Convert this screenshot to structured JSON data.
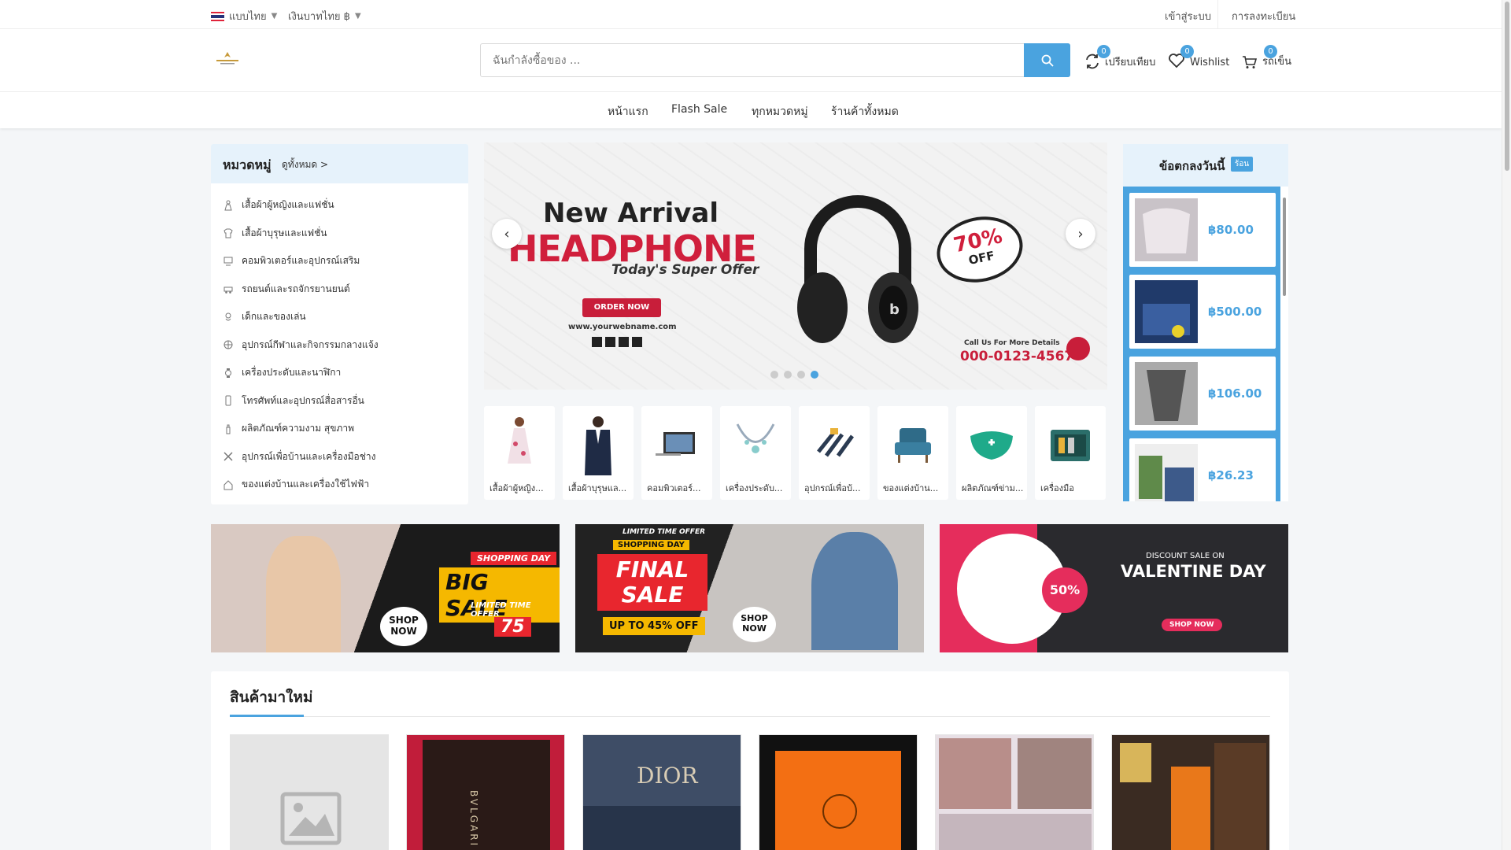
{
  "topbar": {
    "language": "แบบไทย",
    "currency": "เงินบาทไทย ฿",
    "login": "เข้าสู่ระบบ",
    "register": "การลงทะเบียน"
  },
  "header": {
    "search_placeholder": "ฉันกำลังซื้อของ ...",
    "compare": {
      "label": "เปรียบเทียบ",
      "count": "0"
    },
    "wishlist": {
      "label": "Wishlist",
      "count": "0"
    },
    "cart": {
      "label": "รถเข็น",
      "count": "0"
    }
  },
  "nav": {
    "items": [
      "หน้าแรก",
      "Flash Sale",
      "ทุกหมวดหมู่",
      "ร้านค้าทั้งหมด"
    ]
  },
  "categories": {
    "title": "หมวดหมู่",
    "view_all": "ดูทั้งหมด >",
    "items": [
      "เสื้อผ้าผู้หญิงและแฟชั่น",
      "เสื้อผ้าบุรุษและแฟชั่น",
      "คอมพิวเตอร์และอุปกรณ์เสริม",
      "รถยนต์และรถจักรยานยนต์",
      "เด็กและของเล่น",
      "อุปกรณ์กีฬาและกิจกรรมกลางแจ้ง",
      "เครื่องประดับและนาฬิกา",
      "โทรศัพท์และอุปกรณ์สื่อสารอื่น",
      "ผลิตภัณฑ์ความงาม สุขภาพ",
      "อุปกรณ์เพื่อบ้านและเครื่องมือช่าง",
      "ของแต่งบ้านและเครื่องใช้ไฟฟ้า"
    ]
  },
  "slider": {
    "line1": "New Arrival",
    "line2": "HEADPHONE",
    "line3": "Today's Super Offer",
    "cta": "ORDER NOW",
    "website": "www.yourwebname.com",
    "discount": "70%",
    "discount_suffix": "OFF",
    "call_label": "Call Us For More Details",
    "phone": "000-0123-4567",
    "active_slide": 4,
    "slide_count": 4
  },
  "thumbs": [
    {
      "label": "เสื้อผ้าผู้หญิง...",
      "icon": "dress-image"
    },
    {
      "label": "เสื้อผ้าบุรุษแล...",
      "icon": "suit-image"
    },
    {
      "label": "คอมพิวเตอร์...",
      "icon": "computer-image"
    },
    {
      "label": "เครื่องประดับ...",
      "icon": "necklace-image"
    },
    {
      "label": "อุปกรณ์เพื่อบ้...",
      "icon": "tools-image"
    },
    {
      "label": "ของแต่งบ้าน...",
      "icon": "armchair-image"
    },
    {
      "label": "ผลิตภัณฑ์ข่าม...",
      "icon": "mask-image"
    },
    {
      "label": "เครื่องมือ",
      "icon": "toolbox-image"
    }
  ],
  "deals": {
    "title": "ข้อตกลงวันนี้",
    "badge": "ร้อน",
    "items": [
      {
        "price": "฿80.00"
      },
      {
        "price": "฿500.00"
      },
      {
        "price": "฿106.00"
      },
      {
        "price": "฿26.23"
      }
    ]
  },
  "banners": [
    {
      "kicker": "SHOPPING DAY",
      "headline": "BIG SALE",
      "sub": "LIMITED TIME OFFER",
      "value": "75",
      "cta": "SHOP NOW"
    },
    {
      "kicker": "LIMITED TIME OFFER",
      "tag": "SHOPPING DAY",
      "headline": "FINAL SALE",
      "sub": "UP TO 45% OFF",
      "cta": "SHOP NOW"
    },
    {
      "kicker": "DISCOUNT SALE ON",
      "headline": "VALENTINE DAY",
      "value": "50%",
      "cta": "SHOP NOW"
    }
  ],
  "new_arrivals": {
    "title": "สินค้ามาใหม่",
    "products": [
      {
        "image": "placeholder-image"
      },
      {
        "image": "bvlgari-box-image",
        "text": "BVLGARI"
      },
      {
        "image": "dior-pouch-image",
        "text": "DIOR"
      },
      {
        "image": "hermes-bag-image"
      },
      {
        "image": "magazine-image"
      },
      {
        "image": "lv-boxes-image"
      }
    ]
  },
  "colors": {
    "accent": "#4aa3df",
    "sale_red": "#c81e3a"
  }
}
